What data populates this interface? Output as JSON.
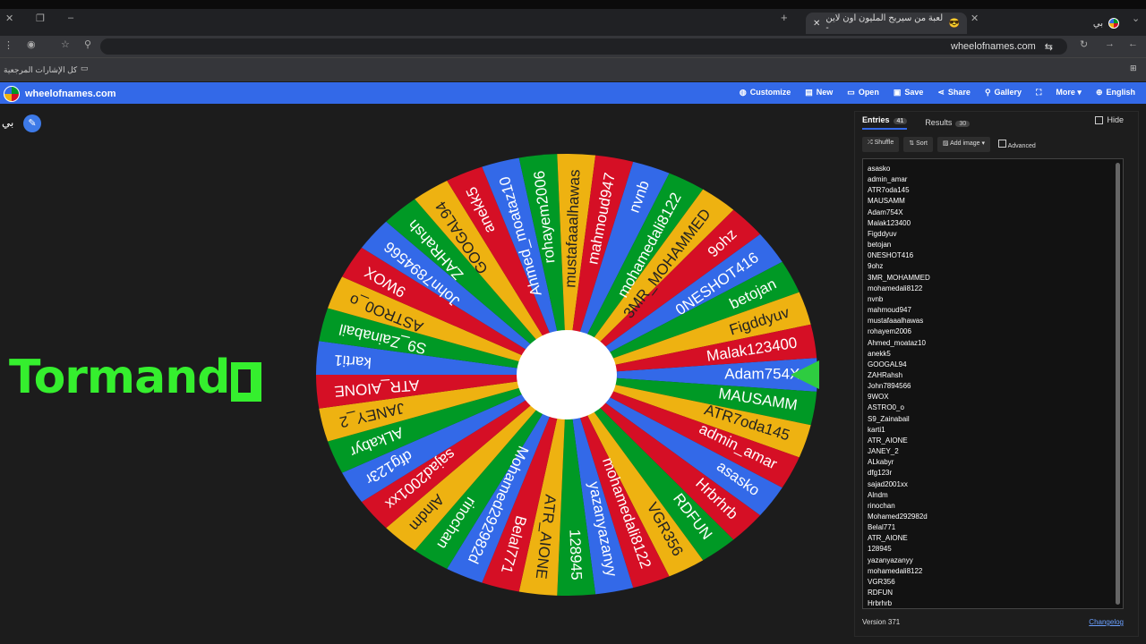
{
  "browser": {
    "tab_title": "لعبة من سيربح المليون اون لاين -",
    "tab2_title": "بي",
    "url": "wheelofnames.com",
    "bookmarks_label": "كل الإشارات المرجعية"
  },
  "app": {
    "site_name": "wheelofnames.com",
    "menu": [
      "Customize",
      "New",
      "Open",
      "Save",
      "Share",
      "Gallery",
      "",
      "More",
      "English"
    ]
  },
  "wheel_title": "بي",
  "overlay_text": "Tormando",
  "panel": {
    "tab_entries": "Entries",
    "entries_count": "41",
    "tab_results": "Results",
    "results_count": "30",
    "hide_label": "Hide",
    "shuffle": "Shuffle",
    "sort": "Sort",
    "add_image": "Add image",
    "advanced": "Advanced",
    "version": "Version 371",
    "changelog": "Changelog"
  },
  "entries": [
    "asasko",
    "admin_amar",
    "ATR7oda145",
    "MAUSAMM",
    "Adam754X",
    "Malak123400",
    "Figddyuv",
    "betojan",
    "0NESHOT416",
    "9ohz",
    "3MR_MOHAMMED",
    "mohamedali8122",
    "nvnb",
    "mahmoud947",
    "mustafaaalhawas",
    "rohayem2006",
    "Ahmed_moataz10",
    "anekk5",
    "GOOGAL94",
    "ZAHRahsh",
    "John7894566",
    "9WOX",
    "ASTRO0_o",
    "S9_Zainabail",
    "karti1",
    "ATR_AIONE",
    "JANEY_2",
    "ALkabyr",
    "dfg123r",
    "sajad2001xx",
    "Alndm",
    "rinochan",
    "Mohamed292982d",
    "Belal771",
    "ATR_AIONE",
    "128945",
    "yazanyazanyy",
    "mohamedali8122",
    "VGR356",
    "RDFUN",
    "Hrbrhrb"
  ],
  "wheel": {
    "start_angle_deg": 0,
    "colors": [
      "#3369e8",
      "#009925",
      "#eeb211",
      "#d50f25"
    ],
    "slices": [
      {
        "label": "Adam754X",
        "color": "#3369e8"
      },
      {
        "label": "MAUSAMM",
        "color": "#009925"
      },
      {
        "label": "ATR7oda145",
        "color": "#eeb211"
      },
      {
        "label": "admin_amar",
        "color": "#d50f25"
      },
      {
        "label": "asasko",
        "color": "#3369e8"
      },
      {
        "label": "Hrbrhrb",
        "color": "#d50f25"
      },
      {
        "label": "RDFUN",
        "color": "#009925"
      },
      {
        "label": "VGR356",
        "color": "#eeb211"
      },
      {
        "label": "mohamedali8122",
        "color": "#d50f25"
      },
      {
        "label": "yazanyazanyy",
        "color": "#3369e8"
      },
      {
        "label": "128945",
        "color": "#009925"
      },
      {
        "label": "ATR_AIONE",
        "color": "#eeb211"
      },
      {
        "label": "Belal771",
        "color": "#d50f25"
      },
      {
        "label": "Mohamed292982d",
        "color": "#3369e8"
      },
      {
        "label": "rinochan",
        "color": "#009925"
      },
      {
        "label": "Alndm",
        "color": "#eeb211"
      },
      {
        "label": "sajad2001xx",
        "color": "#d50f25"
      },
      {
        "label": "dfg123r",
        "color": "#3369e8"
      },
      {
        "label": "ALkabyr",
        "color": "#009925"
      },
      {
        "label": "JANEY_2",
        "color": "#eeb211"
      },
      {
        "label": "ATR_AIONE",
        "color": "#d50f25"
      },
      {
        "label": "karti1",
        "color": "#3369e8"
      },
      {
        "label": "S9_Zainabail",
        "color": "#009925"
      },
      {
        "label": "ASTRO0_o",
        "color": "#eeb211"
      },
      {
        "label": "9WOX",
        "color": "#d50f25"
      },
      {
        "label": "John7894566",
        "color": "#3369e8"
      },
      {
        "label": "ZAHRahsh",
        "color": "#009925"
      },
      {
        "label": "GOOGAL94",
        "color": "#eeb211"
      },
      {
        "label": "anekk5",
        "color": "#d50f25"
      },
      {
        "label": "Ahmed_moataz10",
        "color": "#3369e8"
      },
      {
        "label": "rohayem2006",
        "color": "#009925"
      },
      {
        "label": "mustafaaalhawas",
        "color": "#eeb211"
      },
      {
        "label": "mahmoud947",
        "color": "#d50f25"
      },
      {
        "label": "nvnb",
        "color": "#3369e8"
      },
      {
        "label": "mohamedali8122",
        "color": "#009925"
      },
      {
        "label": "3MR_MOHAMMED",
        "color": "#eeb211"
      },
      {
        "label": "9ohz",
        "color": "#d50f25"
      },
      {
        "label": "0NESHOT416",
        "color": "#3369e8"
      },
      {
        "label": "betojan",
        "color": "#009925"
      },
      {
        "label": "Figddyuv",
        "color": "#eeb211"
      },
      {
        "label": "Malak123400",
        "color": "#d50f25"
      }
    ],
    "pointer_color": "#2ecc40"
  }
}
